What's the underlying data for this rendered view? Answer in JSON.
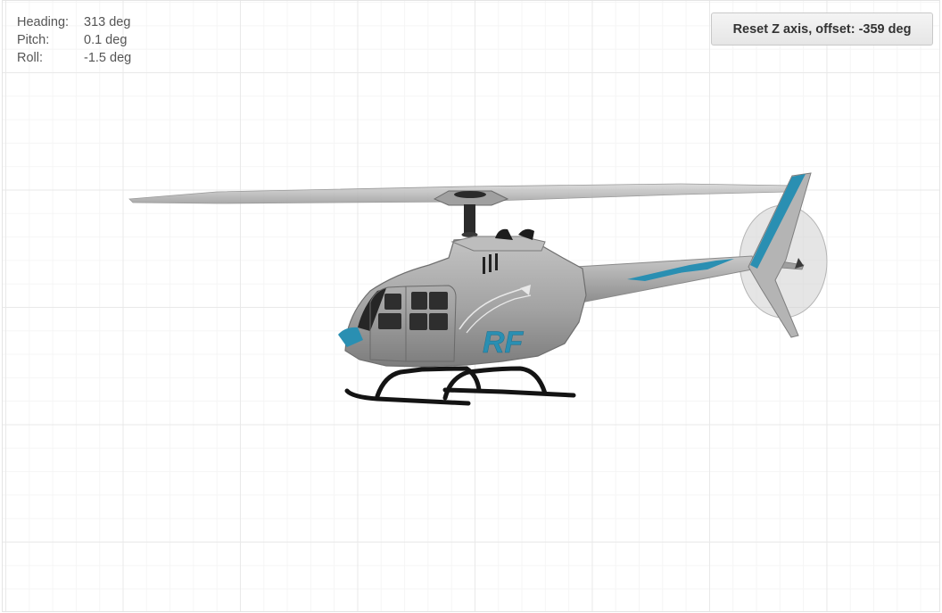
{
  "telemetry": {
    "heading": {
      "label": "Heading:",
      "value": "313 deg"
    },
    "pitch": {
      "label": "Pitch:",
      "value": "0.1 deg"
    },
    "roll": {
      "label": "Roll:",
      "value": "-1.5 deg"
    }
  },
  "reset_button": {
    "label": "Reset Z axis, offset: -359 deg"
  },
  "model": {
    "logo_text": "RF",
    "colors": {
      "background": "#ffffff",
      "grid": "#e9e9e9",
      "body": "#a6a6a6",
      "accent": "#2a8fb2",
      "window": "#2e2e2e",
      "skid": "#1a1a1a"
    }
  }
}
